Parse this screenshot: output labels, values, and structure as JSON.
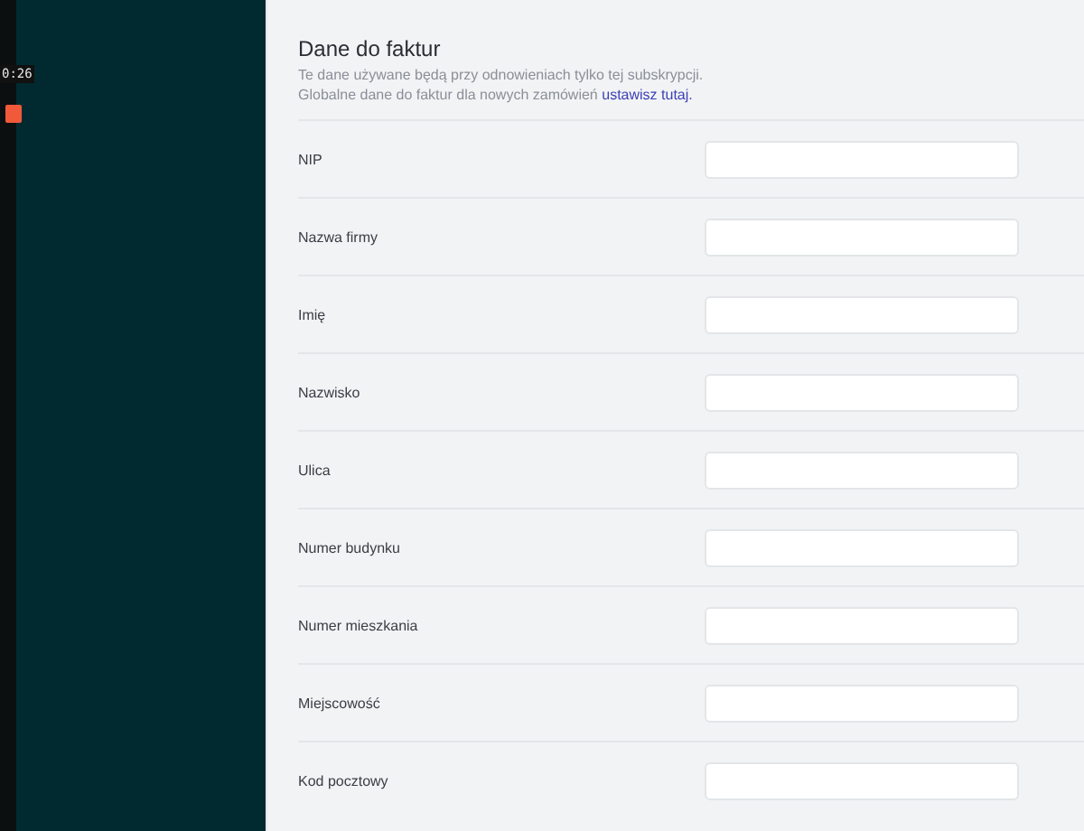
{
  "recorder": {
    "time": "0:26"
  },
  "section": {
    "title": "Dane do faktur",
    "description_1": "Te dane używane będą przy odnowieniach tylko tej subskrypcji.",
    "description_2": "Globalne dane do faktur dla nowych zamówień",
    "link": "ustawisz tutaj."
  },
  "fields": [
    {
      "label": "NIP"
    },
    {
      "label": "Nazwa firmy"
    },
    {
      "label": "Imię"
    },
    {
      "label": "Nazwisko"
    },
    {
      "label": "Ulica"
    },
    {
      "label": "Numer budynku"
    },
    {
      "label": "Numer mieszkania"
    },
    {
      "label": "Miejscowość"
    },
    {
      "label": "Kod pocztowy"
    }
  ]
}
